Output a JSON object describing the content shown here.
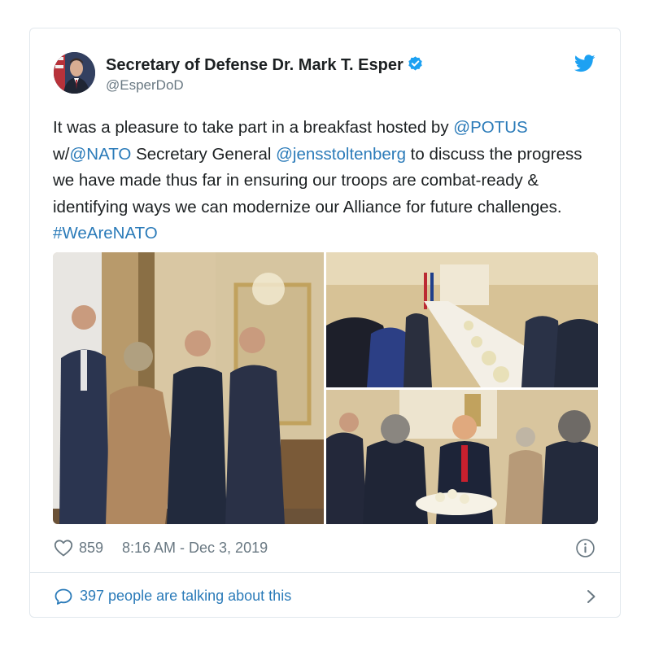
{
  "tweet": {
    "display_name": "Secretary of Defense Dr. Mark T. Esper",
    "handle": "@EsperDoD",
    "text_parts": {
      "p1": "It was a pleasure to take part in a breakfast hosted by ",
      "m1": "@POTUS",
      "p2": " w/",
      "m2": "@NATO",
      "p3": " Secretary General ",
      "m3": "@jensstoltenberg",
      "p4": " to discuss the progress we have made thus far in ensuring our troops are combat-ready & identifying ways we can modernize our Alliance for future challenges. ",
      "h1": "#WeAreNATO"
    },
    "likes": "859",
    "timestamp": "8:16 AM - Dec 3, 2019",
    "talking": "397 people are talking about this"
  },
  "icons": {
    "verified": "verified-badge-icon",
    "bird": "twitter-bird-icon",
    "heart": "heart-icon",
    "info": "info-icon",
    "bubble": "speech-bubble-icon",
    "chevron": "chevron-right-icon"
  },
  "colors": {
    "link": "#2b7bb9",
    "text": "#1c2022",
    "muted": "#697882",
    "border": "#e1e8ed",
    "twitter_blue": "#1da1f2"
  }
}
